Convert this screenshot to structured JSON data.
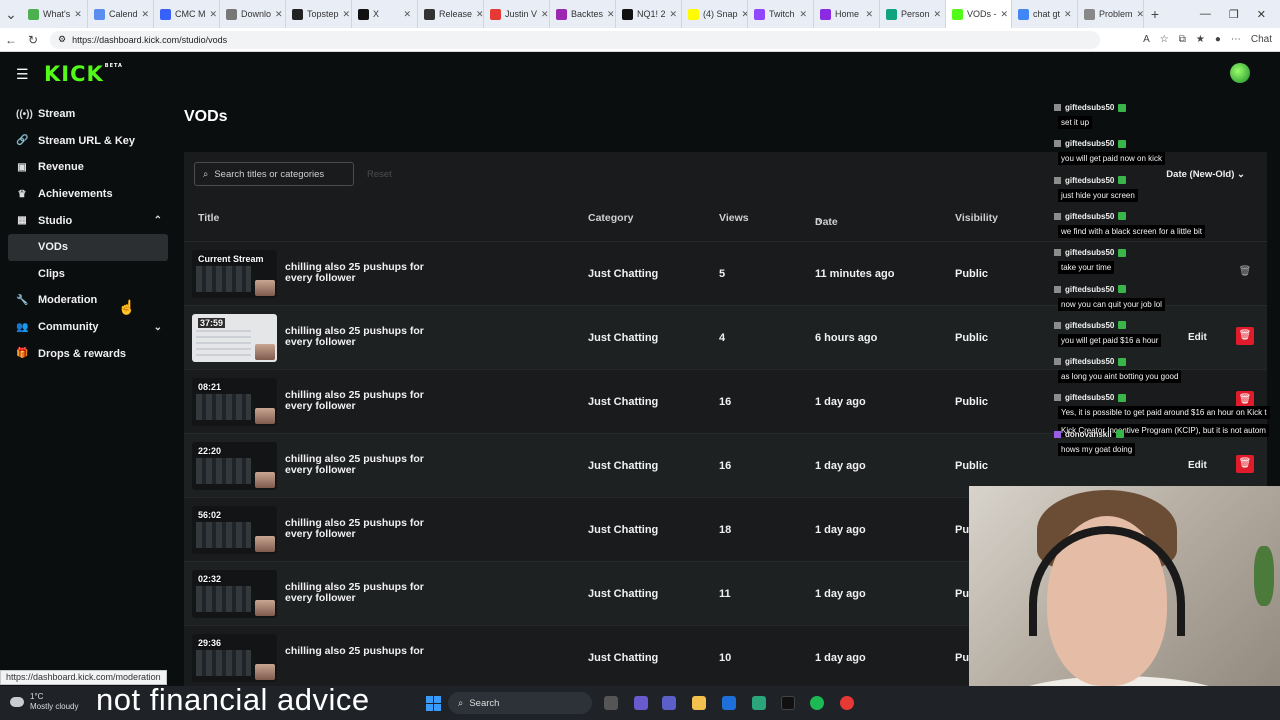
{
  "browser": {
    "tabs": [
      {
        "label": "What's",
        "color": "#4caf50"
      },
      {
        "label": "Calend",
        "color": "#5b8def"
      },
      {
        "label": "CMC M",
        "color": "#3861fb"
      },
      {
        "label": "Downlo",
        "color": "#777777"
      },
      {
        "label": "Topstep",
        "color": "#222222"
      },
      {
        "label": "X",
        "color": "#111111"
      },
      {
        "label": "Release",
        "color": "#333333"
      },
      {
        "label": "Justin V",
        "color": "#e53935"
      },
      {
        "label": "Backtes",
        "color": "#9c27b0"
      },
      {
        "label": "NQ1! 2",
        "color": "#111111"
      },
      {
        "label": "(4) Snap",
        "color": "#fffc00"
      },
      {
        "label": "Twitch",
        "color": "#9146ff"
      },
      {
        "label": "Home",
        "color": "#8a2be2"
      },
      {
        "label": "Person",
        "color": "#10a37f"
      },
      {
        "label": "VODs -",
        "color": "#53fc18"
      },
      {
        "label": "chat gt",
        "color": "#4285f4"
      },
      {
        "label": "Problem",
        "color": "#888888"
      }
    ],
    "active_tab_index": 14,
    "url": "https://dashboard.kick.com/studio/vods",
    "chat_label": "Chat",
    "status_url": "https://dashboard.kick.com/moderation"
  },
  "app": {
    "logo": "KICK",
    "logo_badge": "BETA",
    "page_title": "VODs",
    "accent": "#53fc18",
    "danger": "#e01b2a"
  },
  "sidebar": {
    "items": [
      {
        "label": "Stream",
        "icon": "broadcast-icon"
      },
      {
        "label": "Stream URL & Key",
        "icon": "link-icon"
      },
      {
        "label": "Revenue",
        "icon": "money-icon"
      },
      {
        "label": "Achievements",
        "icon": "trophy-icon"
      },
      {
        "label": "Studio",
        "icon": "film-icon"
      },
      {
        "label": "VODs",
        "icon": ""
      },
      {
        "label": "Clips",
        "icon": ""
      },
      {
        "label": "Moderation",
        "icon": "wrench-icon"
      },
      {
        "label": "Community",
        "icon": "people-icon"
      },
      {
        "label": "Drops & rewards",
        "icon": "gift-icon"
      }
    ]
  },
  "toolbar": {
    "search_placeholder": "Search titles or categories",
    "reset_label": "Reset",
    "sort_label": "Date (New-Old)"
  },
  "table": {
    "columns": [
      "Title",
      "Category",
      "Views",
      "Date",
      "Visibility"
    ],
    "sort_indicator": "^",
    "edit_label": "Edit",
    "rows": [
      {
        "duration": "Current Stream",
        "title": "chilling also 25 pushups for every follower",
        "category": "Just Chatting",
        "views": "5",
        "date": "11 minutes ago",
        "visibility": "Public"
      },
      {
        "duration": "37:59",
        "title": "chilling also 25 pushups for every follower",
        "category": "Just Chatting",
        "views": "4",
        "date": "6 hours ago",
        "visibility": "Public"
      },
      {
        "duration": "08:21",
        "title": "chilling also 25 pushups for every follower",
        "category": "Just Chatting",
        "views": "16",
        "date": "1 day ago",
        "visibility": "Public"
      },
      {
        "duration": "22:20",
        "title": "chilling also 25 pushups for every follower",
        "category": "Just Chatting",
        "views": "16",
        "date": "1 day ago",
        "visibility": "Public"
      },
      {
        "duration": "56:02",
        "title": "chilling also 25 pushups for every follower",
        "category": "Just Chatting",
        "views": "18",
        "date": "1 day ago",
        "visibility": "Pu"
      },
      {
        "duration": "02:32",
        "title": "chilling also 25 pushups for every follower",
        "category": "Just Chatting",
        "views": "11",
        "date": "1 day ago",
        "visibility": "Pu"
      },
      {
        "duration": "29:36",
        "title": "chilling also 25 pushups for",
        "category": "Just Chatting",
        "views": "10",
        "date": "1 day ago",
        "visibility": "Pu"
      }
    ]
  },
  "chat": {
    "messages": [
      {
        "user": "giftedsubs50",
        "text": "set it up"
      },
      {
        "user": "giftedsubs50",
        "text": "you will get paid now on kick"
      },
      {
        "user": "giftedsubs50",
        "text": "just hide your screen"
      },
      {
        "user": "giftedsubs50",
        "text": "we find with a black screen for a little bit"
      },
      {
        "user": "giftedsubs50",
        "text": "take your time"
      },
      {
        "user": "giftedsubs50",
        "text": "now you can quit your job lol"
      },
      {
        "user": "giftedsubs50",
        "text": "you will get paid $16 a hour"
      },
      {
        "user": "giftedsubs50",
        "text": "as long you aint botting you good"
      },
      {
        "user": "giftedsubs50",
        "text": "Yes, it is possible to get paid around $16 an hour on Kick t"
      },
      {
        "user": "donovanskii",
        "text": "hows my goat doing"
      }
    ],
    "extra_line": "Kick Creator Incentive Program (KCIP), but it is not autom"
  },
  "caption": "not financial advice",
  "taskbar": {
    "weather_temp": "1°C",
    "weather_desc": "Mostly cloudy",
    "search_label": "Search"
  }
}
